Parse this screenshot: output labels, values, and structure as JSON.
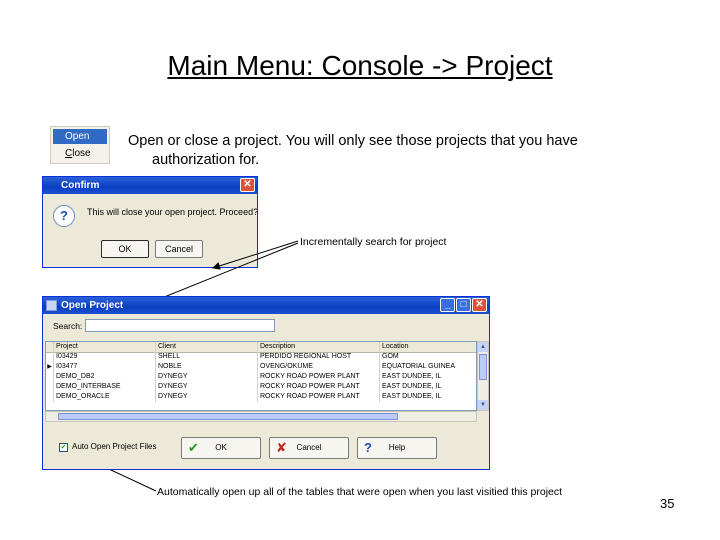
{
  "slide": {
    "title": "Main Menu:  Console -> Project",
    "description_line1": "Open or close a project.  You will only see those projects that you have",
    "description_line2": "authorization for.",
    "callout_search": "Incrementally search for project",
    "callout_autoopen": "Automatically open up all of the tables that were open when you last visitied this project",
    "page_number": "35"
  },
  "menu": {
    "items": [
      {
        "label": "Open",
        "selected": true
      },
      {
        "label_first": "C",
        "label_rest": "lose",
        "selected": false
      }
    ]
  },
  "confirm_dialog": {
    "title": "Confirm",
    "message": "This will close your open project.  Proceed?",
    "ok_label": "OK",
    "cancel_label": "Cancel",
    "close_glyph": "✕"
  },
  "open_project_dialog": {
    "title": "Open Project",
    "search_label": "Search:",
    "search_value": "",
    "columns": [
      "Project",
      "Client",
      "Description",
      "Location"
    ],
    "rows": [
      {
        "project": "I03429",
        "client": "SHELL",
        "description": "PERDIDO REGIONAL HOST",
        "location": "GOM"
      },
      {
        "project": "I03477",
        "client": "NOBLE",
        "description": "OVENG/OKUME",
        "location": "EQUATORIAL GUINEA"
      },
      {
        "project": "DEMO_DB2",
        "client": "DYNEGY",
        "description": "ROCKY ROAD POWER PLANT",
        "location": "EAST DUNDEE, IL"
      },
      {
        "project": "DEMO_INTERBASE",
        "client": "DYNEGY",
        "description": "ROCKY ROAD POWER PLANT",
        "location": "EAST DUNDEE, IL"
      },
      {
        "project": "DEMO_ORACLE",
        "client": "DYNEGY",
        "description": "ROCKY ROAD POWER PLANT",
        "location": "EAST DUNDEE, IL"
      }
    ],
    "current_row_index": 1,
    "auto_open_label": "Auto Open Project Files",
    "auto_open_checked": true,
    "ok_label": "OK",
    "cancel_label": "Cancel",
    "help_label": "Help",
    "title_buttons": [
      "_",
      "□",
      "✕"
    ]
  },
  "colors": {
    "titlebar": "#0a3ec2",
    "dialog_bg": "#ece9d8",
    "menu_highlight": "#316ac5",
    "close_button": "#d8563b"
  }
}
